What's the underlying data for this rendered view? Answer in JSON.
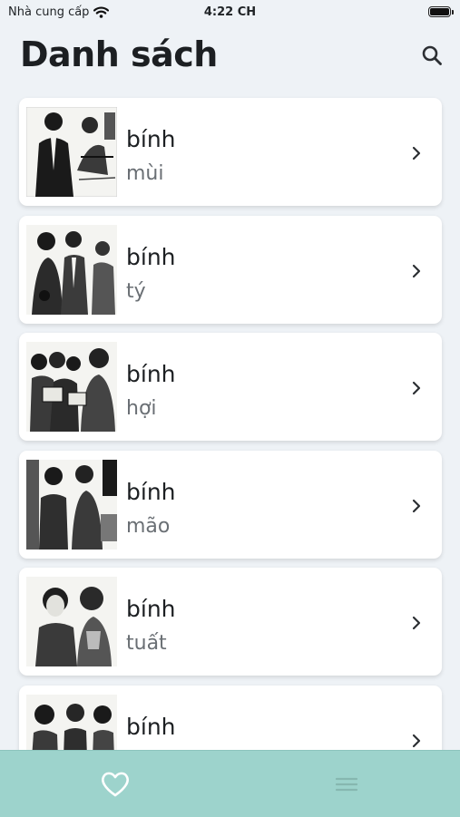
{
  "status_bar": {
    "carrier": "Nhà cung cấp",
    "time": "4:22 CH"
  },
  "header": {
    "title": "Danh sách",
    "search_icon": "search-icon"
  },
  "items": [
    {
      "title": "bính",
      "subtitle": "mùi"
    },
    {
      "title": "bính",
      "subtitle": "tý"
    },
    {
      "title": "bính",
      "subtitle": "hợi"
    },
    {
      "title": "bính",
      "subtitle": "mão"
    },
    {
      "title": "bính",
      "subtitle": "tuất"
    },
    {
      "title": "bính",
      "subtitle": ""
    }
  ],
  "tab_bar": {
    "tabs": [
      {
        "icon": "heart-icon"
      },
      {
        "icon": "menu-icon"
      }
    ]
  },
  "colors": {
    "background": "#eef2f6",
    "tab_bar": "#9dd3cc",
    "subtitle": "#6a6f74",
    "card": "#ffffff"
  }
}
